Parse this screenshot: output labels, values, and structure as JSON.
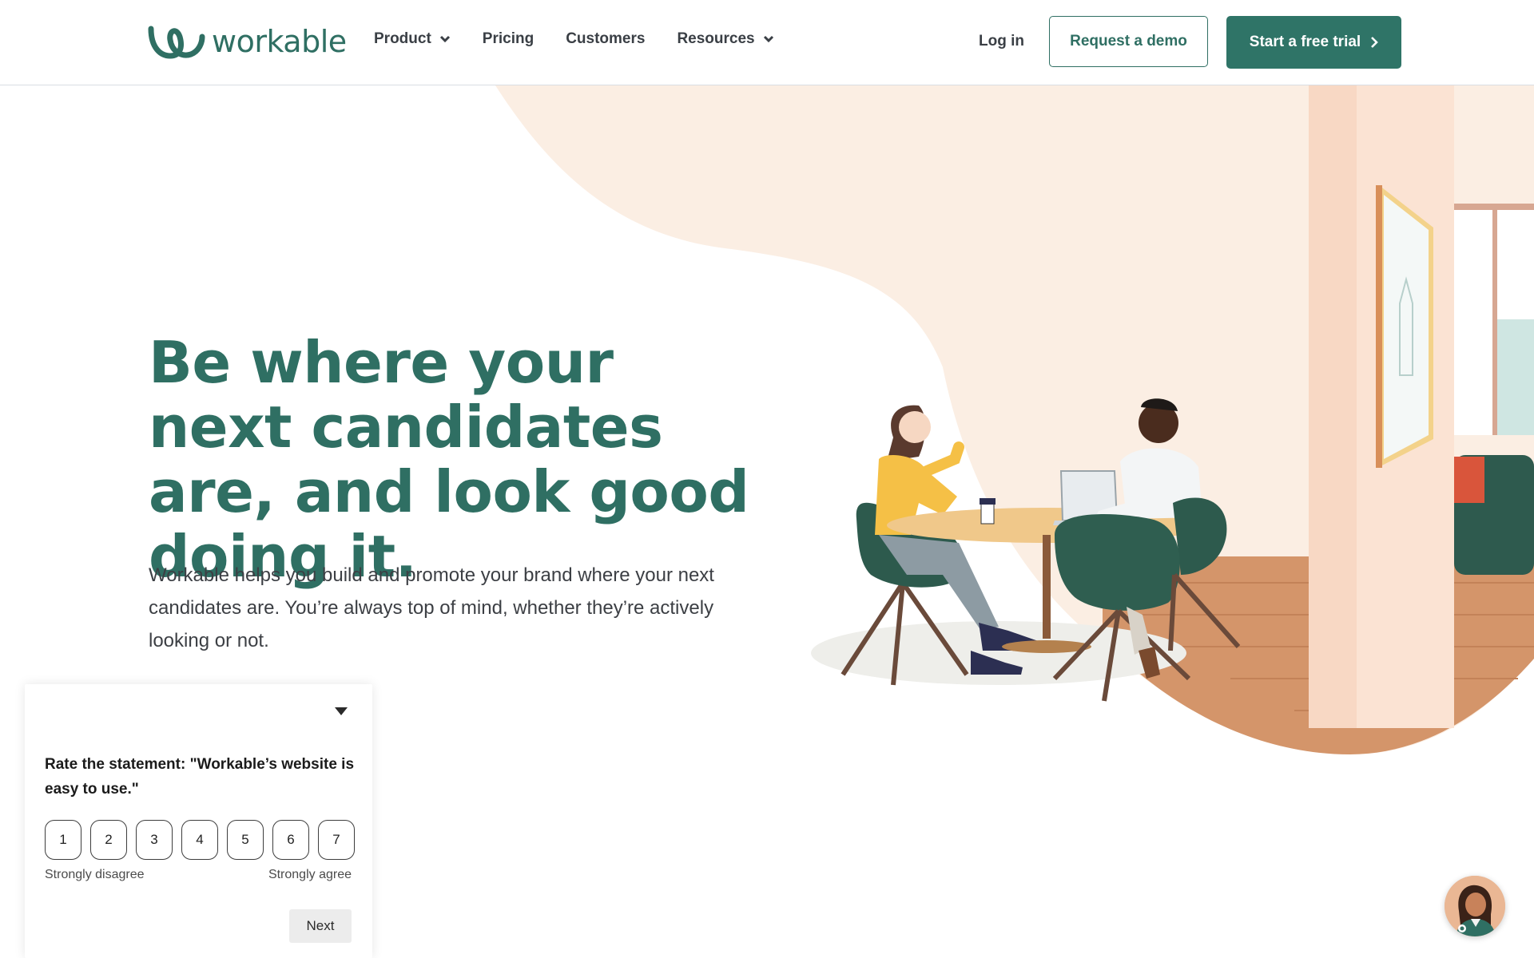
{
  "brand": {
    "name": "workable",
    "primary_color": "#2f6f63"
  },
  "nav": {
    "items": [
      {
        "label": "Product",
        "has_dropdown": true
      },
      {
        "label": "Pricing",
        "has_dropdown": false
      },
      {
        "label": "Customers",
        "has_dropdown": false
      },
      {
        "label": "Resources",
        "has_dropdown": true
      }
    ],
    "login": "Log in",
    "request_demo": "Request a demo",
    "free_trial": "Start a free trial"
  },
  "hero": {
    "title": "Be where your next candidates are, and look good doing it.",
    "subtitle": "Workable helps you build and promote your brand where your next candidates are. You’re always top of mind, whether they’re actively looking or not."
  },
  "survey": {
    "question": "Rate the statement: \"Workable’s website is easy to use.\"",
    "options": [
      "1",
      "2",
      "3",
      "4",
      "5",
      "6",
      "7"
    ],
    "low_label": "Strongly disagree",
    "high_label": "Strongly agree",
    "next": "Next"
  },
  "icons": {
    "dropdown": "chevron-down-icon",
    "trial_arrow": "chevron-right-icon",
    "survey_collapse": "triangle-down-icon"
  }
}
